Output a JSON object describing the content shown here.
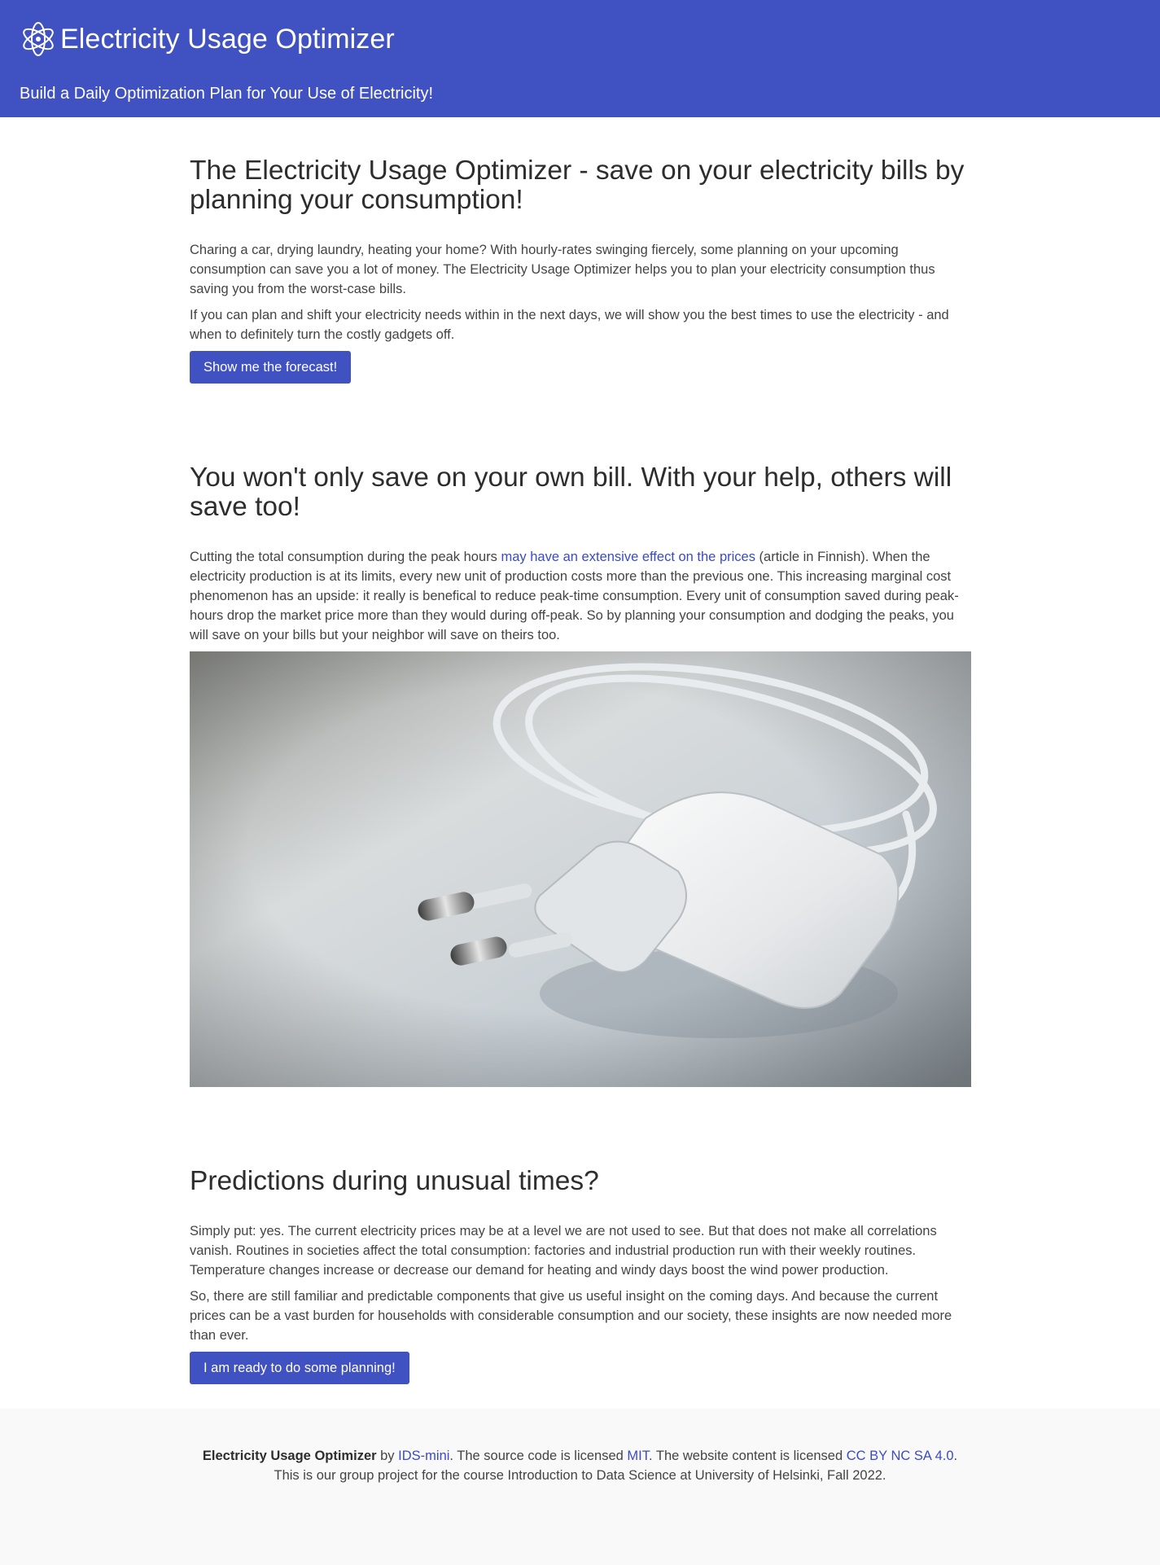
{
  "header": {
    "title": "Electricity Usage Optimizer",
    "subtitle": "Build a Daily Optimization Plan for Your Use of Electricity!",
    "logo_icon": "atom-icon"
  },
  "colors": {
    "brand": "#4051c1",
    "link": "#3a4bc4",
    "footer_bg": "#f9f9f9"
  },
  "section1": {
    "heading": "The Electricity Usage Optimizer - save on your electricity bills by planning your consumption!",
    "p1": "Charing a car, drying laundry, heating your home? With hourly-rates swinging fiercely, some planning on your upcoming consumption can save you a lot of money. The Electricity Usage Optimizer helps you to plan your electricity consumption thus saving you from the worst-case bills.",
    "p2": "If you can plan and shift your electricity needs within in the next days, we will show you the best times to use the electricity - and when to definitely turn the costly gadgets off.",
    "button": "Show me the forecast!"
  },
  "section2": {
    "heading": "You won't only save on your own bill. With your help, others will save too!",
    "p1_before": "Cutting the total consumption during the peak hours ",
    "p1_link": "may have an extensive effect on the prices",
    "p1_after": " (article in Finnish). When the electricity production is at its limits, every new unit of production costs more than the previous one. This increasing marginal cost phenomenon has an upside: it really is benefical to reduce peak-time consumption. Every unit of consumption saved during peak-hours drop the market price more than they would during off-peak. So by planning your consumption and dodging the peaks, you will save on your bills but your neighbor will save on theirs too.",
    "image_icon": "power-adapter-photo"
  },
  "section3": {
    "heading": "Predictions during unusual times?",
    "p1": "Simply put: yes. The current electricity prices may be at a level we are not used to see. But that does not make all correlations vanish. Routines in societies affect the total consumption: factories and industrial production run with their weekly routines. Temperature changes increase or decrease our demand for heating and windy days boost the wind power production.",
    "p2": "So, there are still familiar and predictable components that give us useful insight on the coming days. And because the current prices can be a vast burden for households with considerable consumption and our society, these insights are now needed more than ever.",
    "button": "I am ready to do some planning!"
  },
  "footer": {
    "brand": "Electricity Usage Optimizer",
    "by": " by ",
    "author_link": "IDS-mini",
    "code_text": ". The source code is licensed ",
    "code_license_link": "MIT",
    "content_text": ". The website content is licensed ",
    "content_license_link": "CC BY NC SA 4.0",
    "end": ".",
    "line2": "This is our group project for the course Introduction to Data Science at University of Helsinki, Fall 2022."
  }
}
